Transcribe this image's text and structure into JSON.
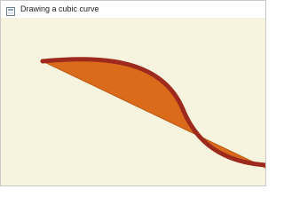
{
  "window": {
    "title": "Drawing a cubic curve",
    "icon": "window-app-icon"
  },
  "canvas": {
    "background": "#f6f3de",
    "curve_color": "#9e2a1e",
    "fill_color": "#d96b1b"
  }
}
